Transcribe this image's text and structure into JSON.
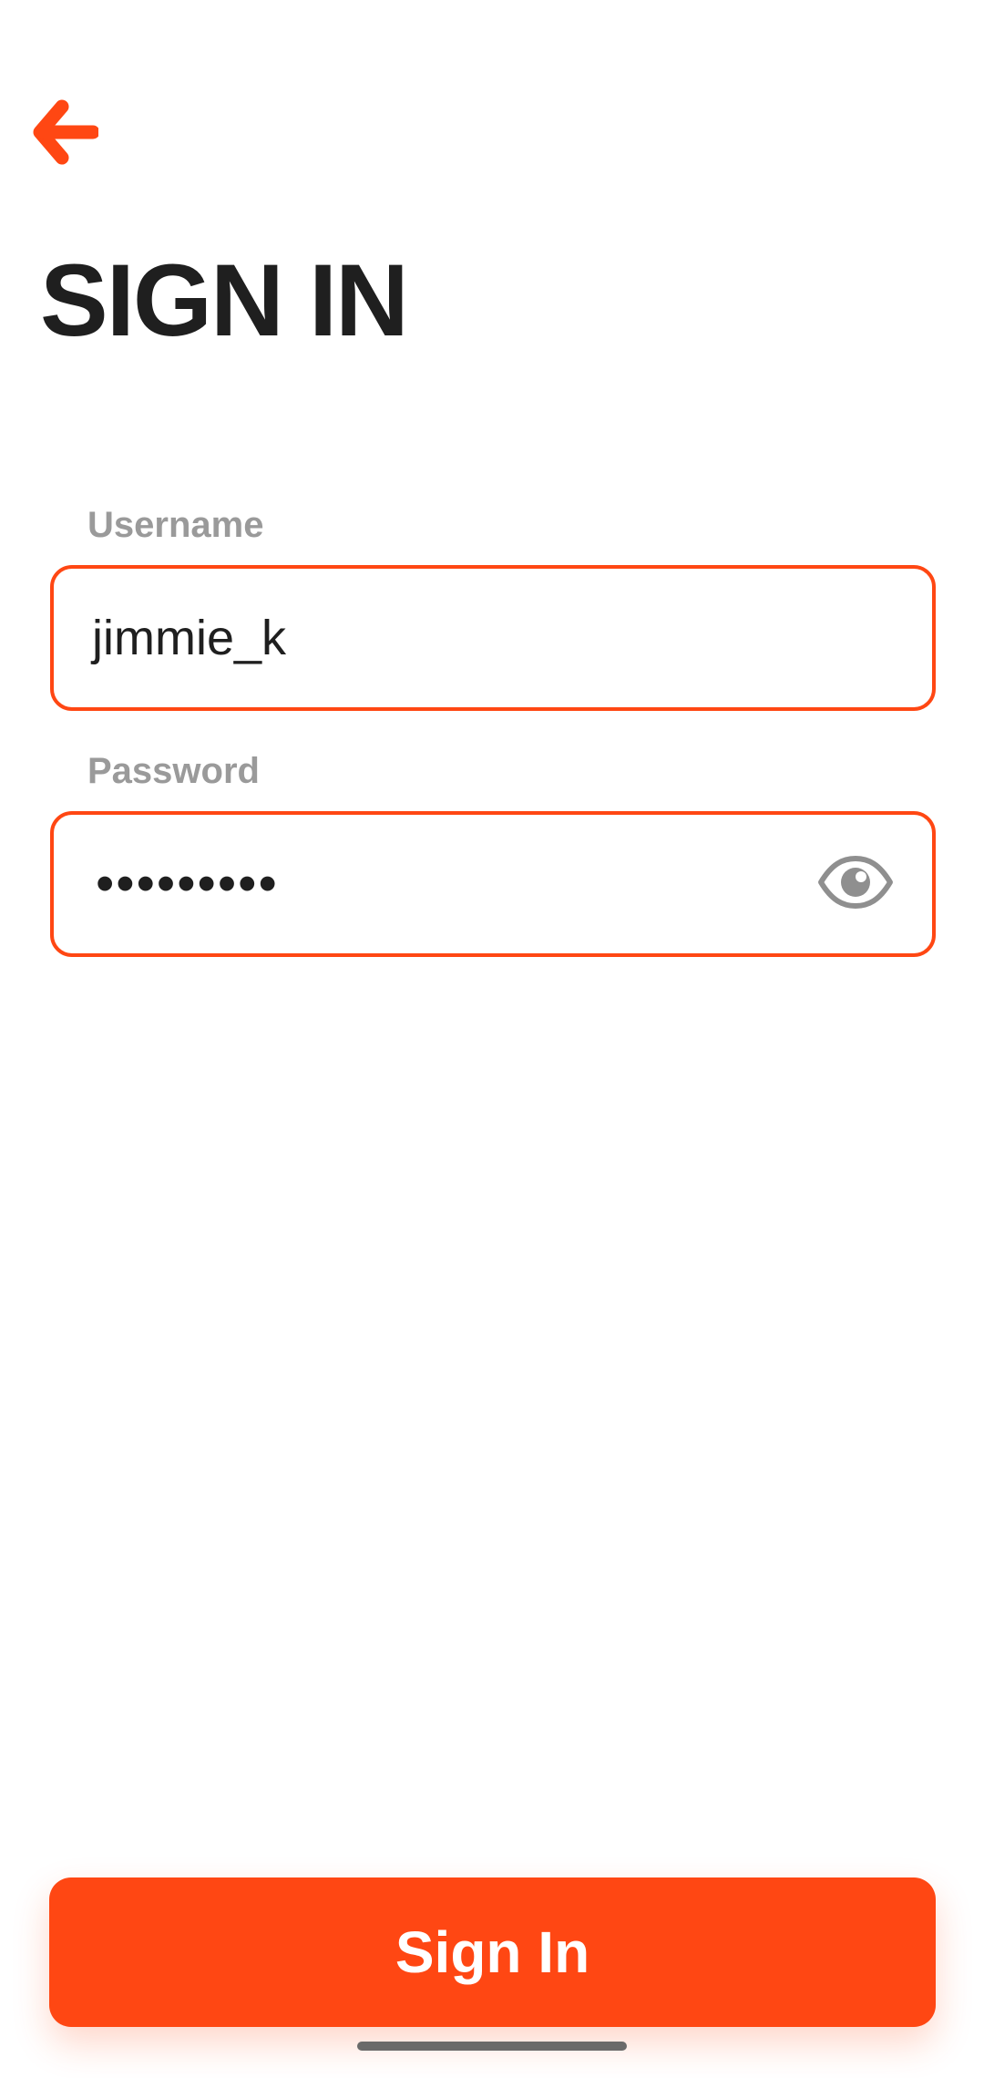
{
  "header": {
    "back_icon": "arrow-left-icon",
    "title": "SIGN IN"
  },
  "form": {
    "username": {
      "label": "Username",
      "value": "jimmie_k"
    },
    "password": {
      "label": "Password",
      "masked_value": "•••••••••",
      "toggle_icon": "eye-icon"
    }
  },
  "actions": {
    "sign_in_label": "Sign In"
  },
  "colors": {
    "accent": "#ff4713",
    "text": "#1f1f1f",
    "label": "#9a9a9a",
    "icon_gray": "#8f8f8f"
  }
}
